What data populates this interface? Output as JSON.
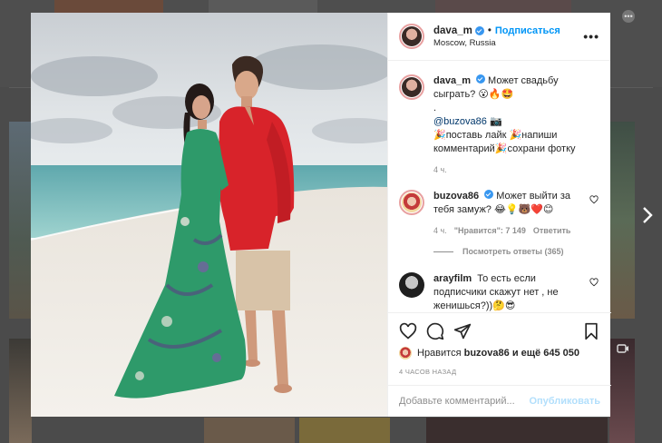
{
  "post": {
    "username": "dava_m",
    "follow_label": "Подписаться",
    "location": "Moscow, Russia"
  },
  "caption": {
    "username": "dava_m",
    "text": "Может свадьбу сыграть? 😮🔥🤩",
    "dot": ".",
    "mention": "@buzova86",
    "mention_emoji": "📷",
    "line2": "🎉поставь лайк 🎉напиши комментарий🎉сохрани фотку",
    "time": "4 ч."
  },
  "comments": [
    {
      "username": "buzova86",
      "text": "Может выйти за тебя замуж? 😂💡🐻❤️😊",
      "time": "4 ч.",
      "likes": "\"Нравится\": 7 149",
      "reply": "Ответить",
      "replies_label": "Посмотреть ответы (365)"
    },
    {
      "username": "arayfilm",
      "text": "То есть если подписчики скажут нет , не женишься?))🤔😎"
    }
  ],
  "likes": {
    "prefix": "Нравится",
    "user": "buzova86",
    "suffix": "и ещё 645 050"
  },
  "timestamp": "4 ЧАСОВ НАЗАД",
  "composer": {
    "placeholder": "Добавьте комментарий...",
    "post_label": "Опубликовать"
  },
  "colors": {
    "accent": "#0095f6",
    "verified": "#3897f0",
    "dress": "#2e9a6a",
    "shirt": "#d8232a"
  },
  "icons": [
    "more-icon",
    "heart-icon",
    "comment-icon",
    "share-icon",
    "bookmark-icon",
    "verified-icon",
    "next-arrow-icon"
  ]
}
